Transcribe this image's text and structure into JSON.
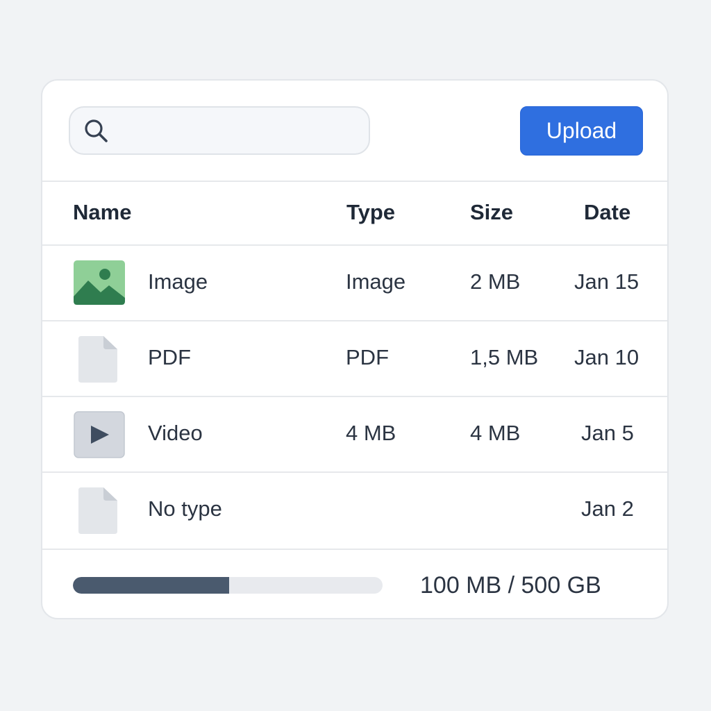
{
  "search": {
    "value": "",
    "placeholder": "",
    "icon": "search-icon"
  },
  "toolbar": {
    "upload_label": "Upload",
    "upload_color": "#2f6fe0"
  },
  "table": {
    "columns": [
      "Name",
      "Type",
      "Size",
      "Date"
    ],
    "rows": [
      {
        "name": "Image",
        "type": "Image",
        "size": "2 MB",
        "date": "Jan 15",
        "icon": "image-file-icon"
      },
      {
        "name": "PDF",
        "type": "PDF",
        "size": "1,5 MB",
        "date": "Jan 10",
        "icon": "document-file-icon"
      },
      {
        "name": "Video",
        "type": "4 MB",
        "size": "4 MB",
        "date": "Jan 5",
        "icon": "video-file-icon"
      },
      {
        "name": "No type",
        "type": "",
        "size": "",
        "date": "Jan 2",
        "icon": "document-file-icon"
      }
    ]
  },
  "storage": {
    "label": "100 MB / 500 GB",
    "progress": 0.505
  }
}
